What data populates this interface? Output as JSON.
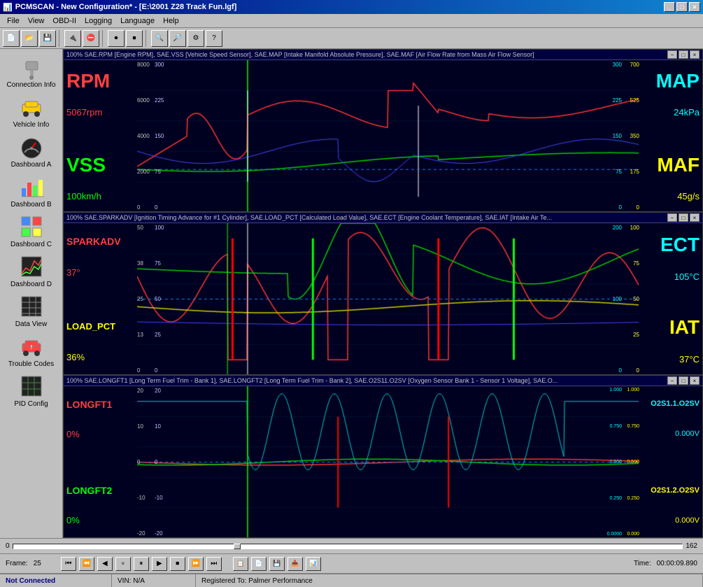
{
  "title": "PCMSCAN - New Configuration* - [E:\\2001 Z28 Track Fun.lgf]",
  "menu": {
    "items": [
      "File",
      "View",
      "OBD-II",
      "Logging",
      "Language",
      "Help"
    ]
  },
  "sidebar": {
    "items": [
      {
        "id": "connection-info",
        "label": "Connection Info",
        "icon": "plug"
      },
      {
        "id": "vehicle-info",
        "label": "Vehicle Info",
        "icon": "car"
      },
      {
        "id": "dashboard-a",
        "label": "Dashboard A",
        "icon": "gauge"
      },
      {
        "id": "dashboard-b",
        "label": "Dashboard B",
        "icon": "bar-chart"
      },
      {
        "id": "dashboard-c",
        "label": "Dashboard C",
        "icon": "grid"
      },
      {
        "id": "dashboard-d",
        "label": "Dashboard D",
        "icon": "chart2"
      },
      {
        "id": "data-view",
        "label": "Data View",
        "icon": "table"
      },
      {
        "id": "trouble-codes",
        "label": "Trouble Codes",
        "icon": "car-error"
      },
      {
        "id": "pid-config",
        "label": "PID Config",
        "icon": "grid2"
      }
    ]
  },
  "chart1": {
    "header": "100% SAE.RPM [Engine RPM], SAE.VSS [Vehicle Speed Sensor], SAE.MAP [Intake Manifold Absolute Pressure], SAE.MAF [Air Flow Rate from Mass Air Flow Sensor]",
    "rpm_label": "RPM",
    "rpm_value": "5067rpm",
    "vss_label": "VSS",
    "vss_value": "100km/h",
    "map_label": "MAP",
    "map_value": "24kPa",
    "maf_label": "MAF",
    "maf_value": "45g/s",
    "left_axis": [
      "8000",
      "6000",
      "4000",
      "2000",
      "0"
    ],
    "left_axis2": [
      "300",
      "225",
      "150",
      "75",
      "0"
    ],
    "right_axis": [
      "300",
      "225",
      "150",
      "75",
      "0"
    ],
    "right_axis2": [
      "700",
      "525",
      "350",
      "175",
      "0"
    ]
  },
  "chart2": {
    "header": "100% SAE.SPARKADV [Ignition Timing Advance for #1 Cylinder], SAE.LOAD_PCT [Calculated Load Value], SAE.ECT [Engine Coolant Temperature], SAE.IAT [Intake Air Te...",
    "sparkadv_label": "SPARKADV",
    "sparkadv_value": "37°",
    "loadpct_label": "LOAD_PCT",
    "loadpct_value": "36%",
    "ect_label": "ECT",
    "ect_value": "105°C",
    "iat_label": "IAT",
    "iat_value": "37°C",
    "left_axis": [
      "50",
      "38",
      "25",
      "13",
      "0"
    ],
    "left_axis2": [
      "100",
      "75",
      "50",
      "25",
      "0"
    ],
    "right_axis": [
      "200",
      "100",
      "0"
    ],
    "right_axis2": [
      "100",
      "75",
      "50",
      "25",
      "0"
    ]
  },
  "chart3": {
    "header": "100% SAE.LONGFT1 [Long Term Fuel Trim - Bank 1], SAE.LONGFT2 [Long Term Fuel Trim - Bank 2], SAE.O2S11.O2SV [Oxygen Sensor Bank 1 - Sensor 1 Voltage], SAE.O...",
    "longft1_label": "LONGFT1",
    "longft1_value": "0%",
    "longft2_label": "LONGFT2",
    "longft2_value": "0%",
    "o2s11_label": "O2S1.1.O2SV",
    "o2s11_value": "0.000V",
    "o2s12_label": "O2S1.2.O2SV",
    "o2s12_value": "0.000V",
    "left_axis": [
      "20",
      "10",
      "0",
      "-10",
      "-20"
    ],
    "left_axis2": [
      "20",
      "10",
      "0",
      "-10",
      "-20"
    ],
    "right_axis": [
      "1.000",
      "0.750",
      "0.500",
      "0.250",
      "0.0000"
    ],
    "right_axis2": [
      "1.000",
      "0.750",
      "0.500",
      "0.250",
      "0.0000"
    ]
  },
  "playback": {
    "min": "0",
    "max": "162",
    "frame_label": "Frame:",
    "frame_value": "25",
    "time_label": "Time:",
    "time_value": "00:00:09.890"
  },
  "status": {
    "connection": "Not Connected",
    "vin": "VIN: N/A",
    "registered": "Registered To: Palmer Performance"
  }
}
